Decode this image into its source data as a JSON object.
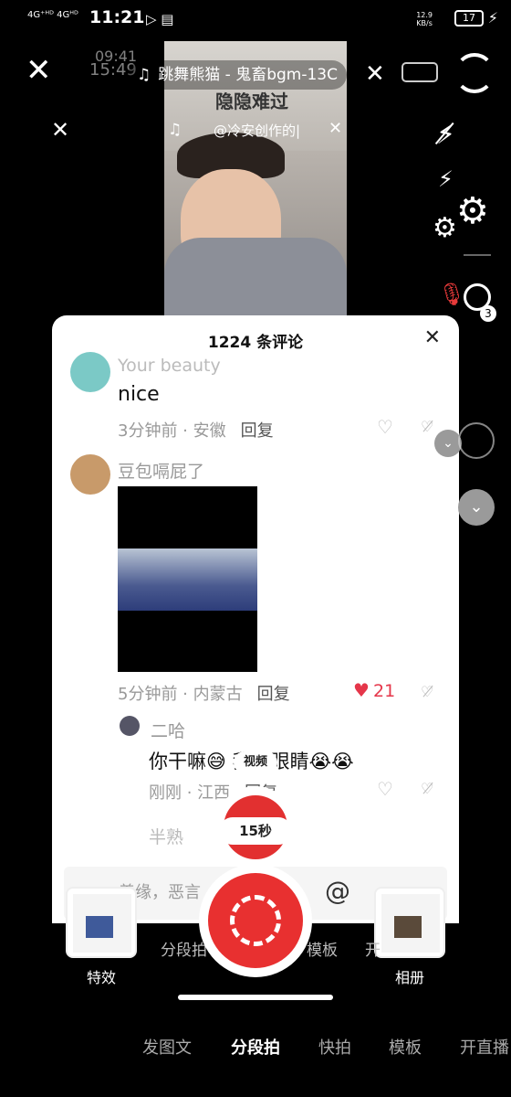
{
  "status_bar": {
    "network": "4G⁺ᴴᴰ 4Gᴴᴰ",
    "time": "11:21",
    "speed": "12.9\nKB/s",
    "battery": "17"
  },
  "top": {
    "music_title": "跳舞熊猫 - 鬼畜bgm-13C",
    "pip_music_title": "@冷安创作的|",
    "camera_sign_text": "隐隐难过",
    "pip_time_a": "09:41",
    "pip_time_b": "15:49"
  },
  "comments_panel": {
    "title": "1224 条评论",
    "comments": [
      {
        "user": "Your beauty",
        "text": "nice",
        "time_loc": "3分钟前 · 安徽",
        "reply": "回复",
        "likes": ""
      },
      {
        "user": "豆包嗝屁了",
        "text": "",
        "time_loc": "5分钟前 · 内蒙古",
        "reply": "回复",
        "likes": "21"
      },
      {
        "user": "二哈",
        "text": "你干嘛😅 我的眼睛😭😭",
        "time_loc": "刚刚 · 江西",
        "reply": "回复",
        "likes": ""
      },
      {
        "user": "半熟",
        "text": "",
        "time_loc": "",
        "reply": "",
        "likes": ""
      }
    ],
    "input_placeholder": "善缘，恶言"
  },
  "recorder": {
    "video_pill": "视频",
    "duration_pill": "15秒",
    "effects_label": "特效",
    "album_label": "相册",
    "ghost_tabs": [
      "分段拍",
      "模板",
      "开"
    ]
  },
  "bottom_tabs": [
    {
      "label": "发图文",
      "active": false
    },
    {
      "label": "分段拍",
      "active": true
    },
    {
      "label": "快拍",
      "active": false
    },
    {
      "label": "模板",
      "active": false
    },
    {
      "label": "开直播",
      "active": false
    }
  ],
  "colors": {
    "record_red": "#e83030",
    "like_red": "#e5364a"
  }
}
